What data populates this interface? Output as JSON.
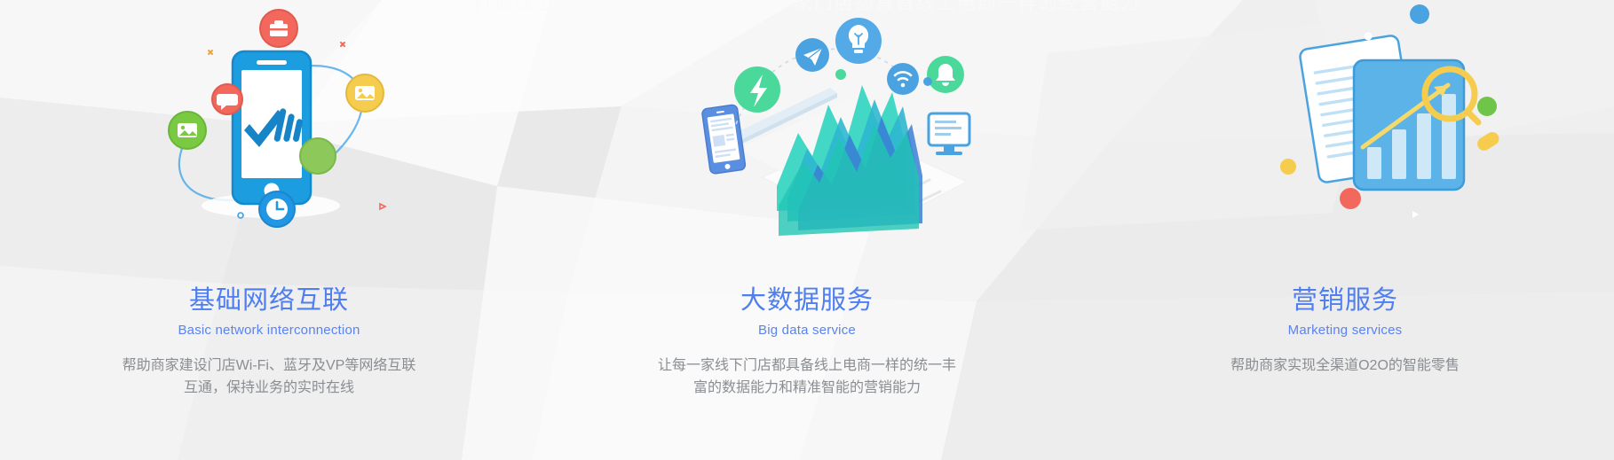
{
  "banner": {
    "top_strip_text": "打通线上线下 构建智慧门店 让每一家门店都具备线上电商一样的经营能力"
  },
  "theme": {
    "title_color": "#4e7ef0",
    "subtitle_color": "#5a83f2",
    "desc_color": "#8a8d92",
    "background_color": "#f0f0f0",
    "accent_blue": "#2196e3",
    "accent_green": "#4ad99a",
    "accent_red": "#f2685c",
    "accent_yellow": "#f6cc4e",
    "accent_teal": "#2ad2c0"
  },
  "columns": [
    {
      "id": "basic-network",
      "title": "基础网络互联",
      "subtitle": "Basic network interconnection",
      "description": "帮助商家建设门店Wi-Fi、蓝牙及VP等网络互联\n互通，保持业务的实时在线",
      "art": {
        "name": "phone-connectivity-illustration",
        "icons": [
          {
            "name": "briefcase-icon",
            "color": "#f2685c"
          },
          {
            "name": "chat-bubble-icon",
            "color": "#f2685c"
          },
          {
            "name": "image-gallery-icon",
            "color": "#7ac943"
          },
          {
            "name": "card-photo-icon",
            "color": "#f6cc4e"
          },
          {
            "name": "clock-icon",
            "color": "#2196e3"
          },
          {
            "name": "green-dot-icon",
            "color": "#8dc95a"
          },
          {
            "name": "checkmark-bars-icon",
            "color": "#1784c8"
          }
        ]
      }
    },
    {
      "id": "big-data",
      "title": "大数据服务",
      "subtitle": "Big data service",
      "description": "让每一家线下门店都具备线上电商一样的统一丰\n富的数据能力和精准智能的营销能力",
      "art": {
        "name": "big-data-chart-illustration",
        "icons": [
          {
            "name": "lightning-bolt-icon",
            "color": "#4ad99a"
          },
          {
            "name": "paper-plane-icon",
            "color": "#4aa3e0"
          },
          {
            "name": "lightbulb-icon",
            "color": "#4aa3e0"
          },
          {
            "name": "wifi-icon",
            "color": "#4aa3e0"
          },
          {
            "name": "bell-icon",
            "color": "#4ad99a"
          },
          {
            "name": "monitor-icon",
            "color": "#4aa3e0"
          },
          {
            "name": "smartphone-icon",
            "color": "#5a8ee0"
          },
          {
            "name": "area-chart-icon",
            "color": "#2ad2c0"
          }
        ]
      }
    },
    {
      "id": "marketing",
      "title": "营销服务",
      "subtitle": "Marketing services",
      "description": "帮助商家实现全渠道O2O的智能零售",
      "art": {
        "name": "marketing-report-illustration",
        "icons": [
          {
            "name": "document-icon",
            "color": "#ffffff"
          },
          {
            "name": "bar-chart-card-icon",
            "color": "#5bb3e8"
          },
          {
            "name": "magnifier-growth-icon",
            "color": "#f6cc4e"
          },
          {
            "name": "green-dot-icon",
            "color": "#6fc44a"
          },
          {
            "name": "red-dot-icon",
            "color": "#f2685c"
          },
          {
            "name": "yellow-dot-icon",
            "color": "#f6cc4e"
          },
          {
            "name": "blue-dot-icon",
            "color": "#4aa3e0"
          },
          {
            "name": "yellow-pill-icon",
            "color": "#f6cc4e"
          }
        ]
      }
    }
  ]
}
